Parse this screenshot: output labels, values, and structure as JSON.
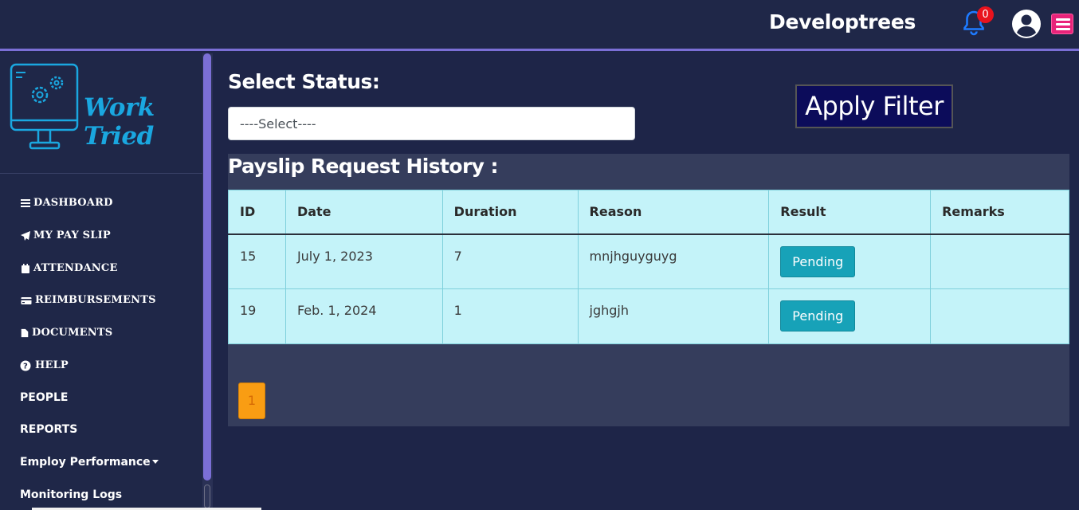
{
  "header": {
    "brand": "Developtrees",
    "notification_count": "0"
  },
  "sidebar": {
    "logo_text": "Work Tried",
    "items": [
      {
        "label": "DASHBOARD",
        "icon": "bars-icon"
      },
      {
        "label": "MY PAY SLIP",
        "icon": "paper-plane-icon"
      },
      {
        "label": "ATTENDANCE",
        "icon": "calendar-icon"
      },
      {
        "label": "REIMBURSEMENTS",
        "icon": "credit-card-icon"
      },
      {
        "label": "DOCUMENTS",
        "icon": "file-icon"
      },
      {
        "label": "HELP",
        "icon": "question-circle-icon"
      },
      {
        "label": "PEOPLE"
      },
      {
        "label": "REPORTS"
      },
      {
        "label": "Employ Performance"
      },
      {
        "label": "Monitoring Logs"
      }
    ]
  },
  "filter": {
    "label": "Select Status:",
    "select_value": "----Select----",
    "apply_label": "Apply Filter"
  },
  "history": {
    "title": "Payslip Request History :",
    "columns": [
      "ID",
      "Date",
      "Duration",
      "Reason",
      "Result",
      "Remarks"
    ],
    "rows": [
      {
        "id": "15",
        "date": "July 1, 2023",
        "duration": "7",
        "reason": "mnjhguyguyg",
        "result": "Pending",
        "remarks": ""
      },
      {
        "id": "19",
        "date": "Feb. 1, 2024",
        "duration": "1",
        "reason": "jghgjh",
        "result": "Pending",
        "remarks": ""
      }
    ],
    "page": "1"
  },
  "colors": {
    "background": "#1e2548",
    "accent": "#7b6fd6",
    "table_bg": "#c4f3f9",
    "pending": "#17a2b8",
    "page_active": "#f99d13",
    "apply_bg": "#0c0c5a"
  }
}
